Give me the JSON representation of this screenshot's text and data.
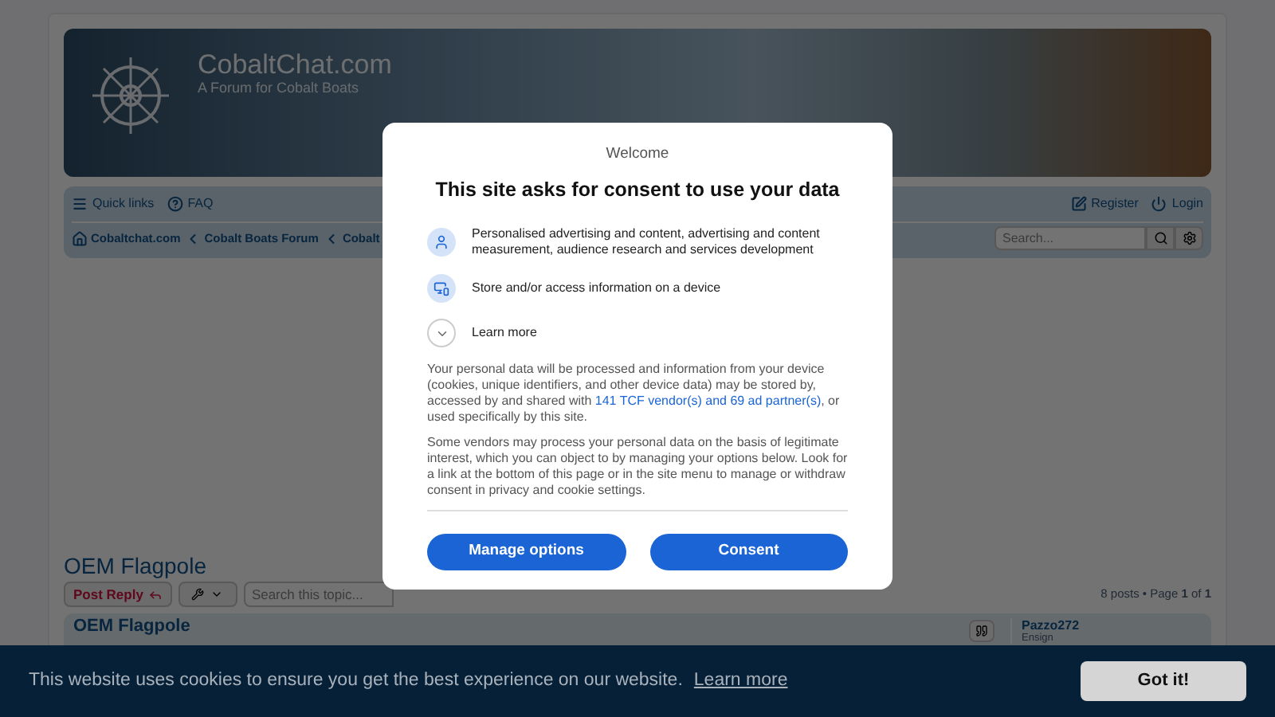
{
  "header": {
    "site_title": "CobaltChat.com",
    "tagline": "A Forum for Cobalt Boats"
  },
  "navbar": {
    "left": [
      {
        "kind": "menu",
        "label": "Quick links"
      },
      {
        "kind": "help",
        "label": "FAQ"
      }
    ],
    "right": [
      {
        "kind": "edit",
        "label": "Register"
      },
      {
        "kind": "power",
        "label": "Login"
      }
    ]
  },
  "breadcrumbs": [
    {
      "kind": "home",
      "label": "Cobaltchat.com"
    },
    {
      "kind": "chevron",
      "label": "Cobalt Boats Forum"
    },
    {
      "kind": "chevron",
      "label": "Cobalt"
    }
  ],
  "search": {
    "placeholder": "Search..."
  },
  "topic": {
    "title": "OEM Flagpole",
    "post_reply": "Post Reply",
    "search_placeholder": "Search this topic...",
    "pagination": "8 posts • Page **1** of **1**"
  },
  "post": {
    "title": "OEM Flagpole",
    "author": "Pazzo272",
    "rank": "Ensign"
  },
  "consent": {
    "welcome": "Welcome",
    "title": "This site asks for consent to use your data",
    "purposes": [
      {
        "kind": "person",
        "text": "Personalised advertising and content, advertising and content measurement, audience research and services development"
      },
      {
        "kind": "device",
        "text": "Store and/or access information on a device"
      }
    ],
    "learn_more": "Learn more",
    "paragraph_1": {
      "before": "Your personal data will be processed and information from your device (cookies, unique identifiers, and other device data) may be stored by, accessed by and shared with",
      "link": "141 TCF vendor(s) and 69 ad partner(s)",
      "after": ", or used specifically by this site."
    },
    "paragraph_2": "Some vendors may process your personal data on the basis of legitimate interest, which you can object to by managing your options below. Look for a link at the bottom of this page or in the site menu to manage or withdraw consent in privacy and cookie settings.",
    "buttons": [
      "Manage options",
      "Consent"
    ]
  },
  "cookie_bar": {
    "message": "This website uses cookies to ensure you get the best experience on our website.",
    "link": "Learn more",
    "button": "Got it!"
  }
}
